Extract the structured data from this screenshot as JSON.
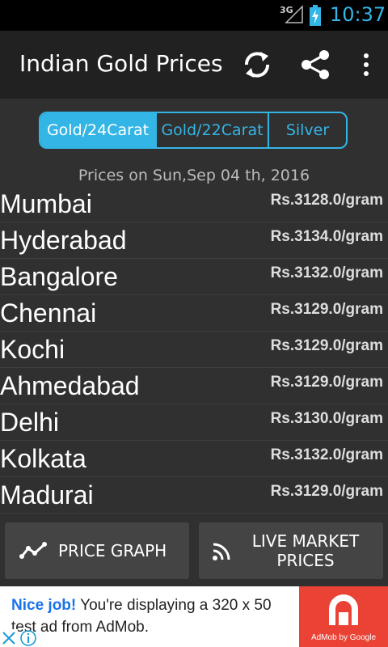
{
  "status_bar": {
    "network": "3G",
    "time": "10:37"
  },
  "action_bar": {
    "title": "Indian Gold Prices",
    "icons": [
      "refresh-icon",
      "share-icon",
      "overflow-menu-icon"
    ]
  },
  "tabs": [
    {
      "label": "Gold/24Carat",
      "selected": true
    },
    {
      "label": "Gold/22Carat",
      "selected": false
    },
    {
      "label": "Silver",
      "selected": false
    }
  ],
  "date_text": "Prices on Sun,Sep 04 th, 2016",
  "prices": [
    {
      "city": "Mumbai",
      "price": "Rs.3128.0/gram"
    },
    {
      "city": "Hyderabad",
      "price": "Rs.3134.0/gram"
    },
    {
      "city": "Bangalore",
      "price": "Rs.3132.0/gram"
    },
    {
      "city": "Chennai",
      "price": "Rs.3129.0/gram"
    },
    {
      "city": "Kochi",
      "price": "Rs.3129.0/gram"
    },
    {
      "city": "Ahmedabad",
      "price": "Rs.3129.0/gram"
    },
    {
      "city": "Delhi",
      "price": "Rs.3130.0/gram"
    },
    {
      "city": "Kolkata",
      "price": "Rs.3132.0/gram"
    },
    {
      "city": "Madurai",
      "price": "Rs.3129.0/gram"
    }
  ],
  "buttons": {
    "price_graph": "PRICE GRAPH",
    "live_market_line1": "LIVE MARKET",
    "live_market_line2": "PRICES"
  },
  "ad": {
    "headline": "Nice job!",
    "body": " You're displaying a 320 x 50 test ad from AdMob.",
    "brand": "AdMob by Google"
  },
  "colors": {
    "accent": "#33b5e5",
    "background": "#303030",
    "action_bar": "#212121",
    "ad_brand": "#ea4335"
  }
}
